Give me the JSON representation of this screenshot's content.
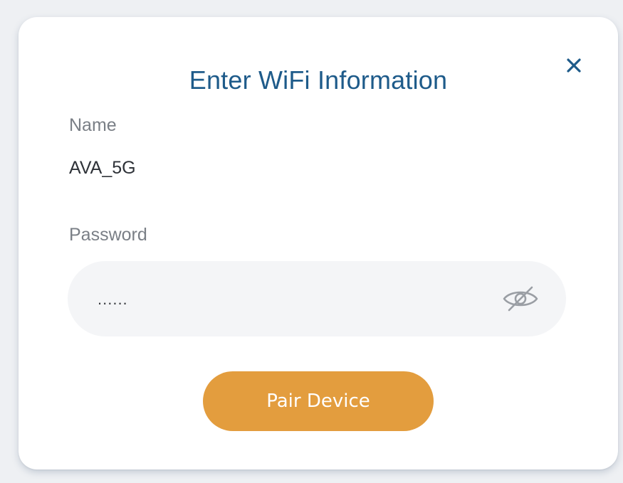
{
  "dialog": {
    "title": "Enter WiFi Information",
    "close_icon": "close-icon",
    "title_color": "#1e5b8a"
  },
  "form": {
    "name_label": "Name",
    "name_value": "AVA_5G",
    "password_label": "Password",
    "password_value": "......",
    "password_visibility_icon": "eye-off-icon"
  },
  "actions": {
    "pair_label": "Pair Device",
    "pair_color": "#e39d3e"
  }
}
